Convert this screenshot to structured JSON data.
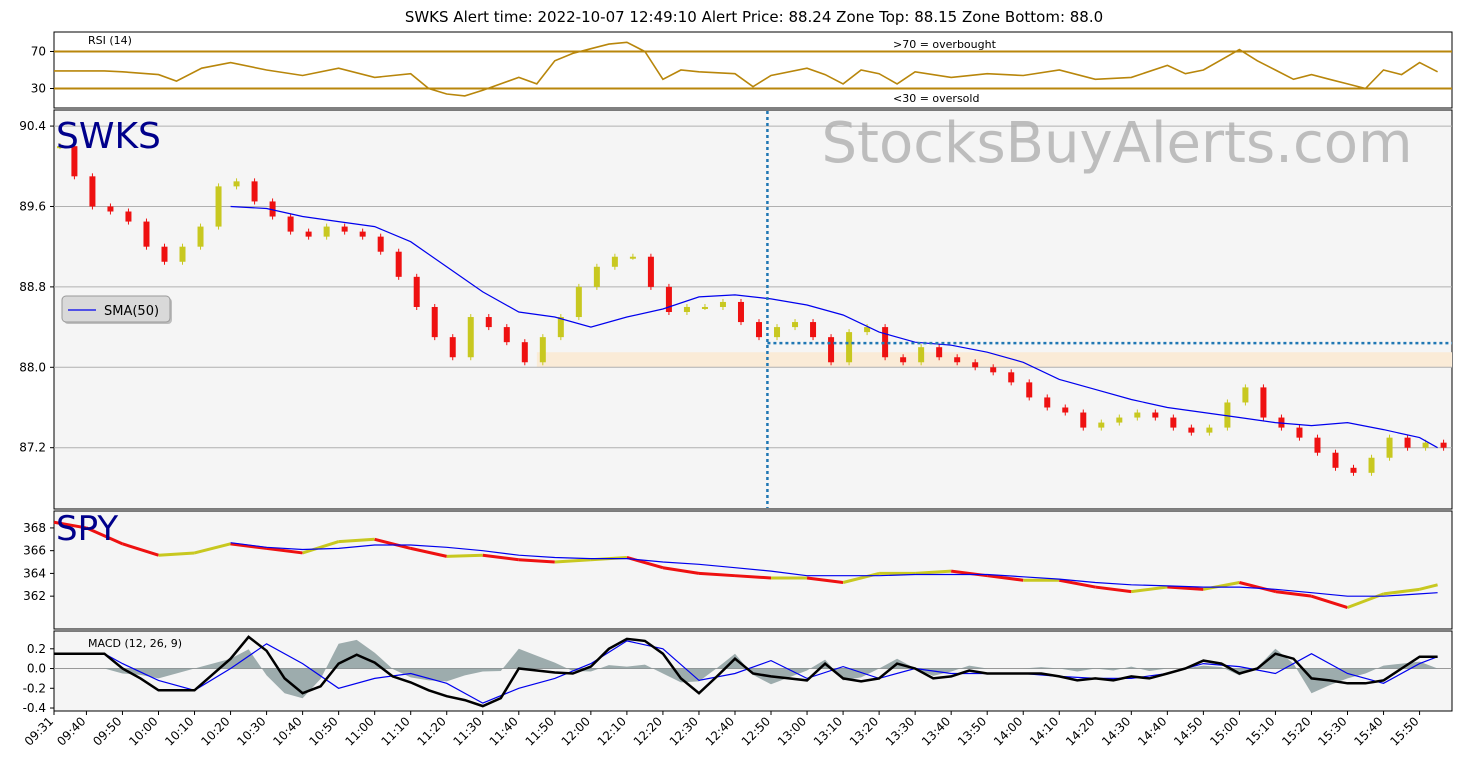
{
  "title": "SWKS   Alert time: 2022-10-07 12:49:10         Alert Price: 88.24       Zone Top: 88.15  Zone Bottom: 88.0",
  "watermark": "StocksBuyAlerts.com",
  "colors": {
    "up": "#c8c820",
    "down": "#ee1111",
    "sma": "#0000ee",
    "rsi": "#b8860b",
    "grid": "#b0b0b0",
    "panel_bg": "#f5f5f5",
    "zone": "#faebd7",
    "volume": "#add8e6",
    "alert_line": "#1f77b4",
    "ticker": "#00008b",
    "macd": "#000000",
    "macd_signal": "#0000ee",
    "macd_hist": "#7f9394"
  },
  "x_axis": {
    "tick_labels": [
      "09:31",
      "09:40",
      "09:50",
      "10:00",
      "10:10",
      "10:20",
      "10:30",
      "10:40",
      "10:50",
      "11:00",
      "11:10",
      "11:20",
      "11:30",
      "11:40",
      "11:50",
      "12:00",
      "12:10",
      "12:20",
      "12:30",
      "12:40",
      "12:50",
      "13:00",
      "13:10",
      "13:20",
      "13:30",
      "13:40",
      "13:50",
      "14:00",
      "14:10",
      "14:20",
      "14:30",
      "14:40",
      "14:50",
      "15:00",
      "15:10",
      "15:20",
      "15:30",
      "15:40",
      "15:50"
    ]
  },
  "chart_data": [
    {
      "type": "line",
      "panel": "rsi",
      "label": "RSI (14)",
      "ylim": [
        10,
        90
      ],
      "yticks": [
        30,
        70
      ],
      "overbought_label": ">70 = overbought",
      "oversold_label": "<30 = oversold",
      "series": [
        {
          "name": "RSI (14)",
          "x": [
            "09:31",
            "09:45",
            "09:50",
            "10:00",
            "10:05",
            "10:12",
            "10:20",
            "10:30",
            "10:40",
            "10:50",
            "11:00",
            "11:10",
            "11:15",
            "11:20",
            "11:25",
            "11:30",
            "11:40",
            "11:45",
            "11:50",
            "11:55",
            "12:00",
            "12:05",
            "12:10",
            "12:15",
            "12:20",
            "12:25",
            "12:30",
            "12:40",
            "12:45",
            "12:50",
            "13:00",
            "13:05",
            "13:10",
            "13:15",
            "13:20",
            "13:25",
            "13:30",
            "13:40",
            "13:50",
            "14:00",
            "14:10",
            "14:20",
            "14:30",
            "14:40",
            "14:45",
            "14:50",
            "15:00",
            "15:05",
            "15:10",
            "15:15",
            "15:20",
            "15:25",
            "15:30",
            "15:35",
            "15:40",
            "15:45",
            "15:50",
            "15:55"
          ],
          "values": [
            49,
            49,
            48,
            45,
            38,
            52,
            58,
            50,
            44,
            52,
            42,
            46,
            30,
            24,
            22,
            28,
            42,
            35,
            60,
            68,
            73,
            78,
            80,
            70,
            40,
            50,
            48,
            46,
            32,
            44,
            52,
            45,
            35,
            50,
            46,
            35,
            48,
            42,
            46,
            44,
            50,
            40,
            42,
            55,
            46,
            50,
            72,
            60,
            50,
            40,
            45,
            40,
            35,
            30,
            50,
            45,
            58,
            48
          ]
        }
      ]
    },
    {
      "type": "bar",
      "panel": "price",
      "ticker": "SWKS",
      "ylim": [
        86.6,
        90.55
      ],
      "yticks": [
        87.2,
        88.0,
        88.8,
        89.6,
        90.4
      ],
      "alert_time": "12:49",
      "alert_price": 88.24,
      "zone_top": 88.15,
      "zone_bottom": 88.0,
      "legend": "SMA(50)",
      "series": [
        {
          "name": "close",
          "x": [
            "09:31",
            "09:35",
            "09:40",
            "09:45",
            "09:50",
            "09:55",
            "10:00",
            "10:05",
            "10:10",
            "10:15",
            "10:20",
            "10:25",
            "10:30",
            "10:35",
            "10:40",
            "10:45",
            "10:50",
            "10:55",
            "11:00",
            "11:05",
            "11:10",
            "11:15",
            "11:20",
            "11:25",
            "11:30",
            "11:35",
            "11:40",
            "11:45",
            "11:50",
            "11:55",
            "12:00",
            "12:05",
            "12:10",
            "12:15",
            "12:20",
            "12:25",
            "12:30",
            "12:35",
            "12:40",
            "12:45",
            "12:50",
            "12:55",
            "13:00",
            "13:05",
            "13:10",
            "13:15",
            "13:20",
            "13:25",
            "13:30",
            "13:35",
            "13:40",
            "13:45",
            "13:50",
            "13:55",
            "14:00",
            "14:05",
            "14:10",
            "14:15",
            "14:20",
            "14:25",
            "14:30",
            "14:35",
            "14:40",
            "14:45",
            "14:50",
            "14:55",
            "15:00",
            "15:05",
            "15:10",
            "15:15",
            "15:20",
            "15:25",
            "15:30",
            "15:35",
            "15:40",
            "15:45",
            "15:50",
            "15:55"
          ],
          "values": [
            90.2,
            89.9,
            89.6,
            89.55,
            89.45,
            89.2,
            89.05,
            89.2,
            89.4,
            89.8,
            89.85,
            89.65,
            89.5,
            89.35,
            89.3,
            89.4,
            89.35,
            89.3,
            89.15,
            88.9,
            88.6,
            88.3,
            88.1,
            88.5,
            88.4,
            88.25,
            88.05,
            88.3,
            88.5,
            88.8,
            89.0,
            89.1,
            89.1,
            88.8,
            88.55,
            88.6,
            88.6,
            88.65,
            88.45,
            88.3,
            88.4,
            88.45,
            88.3,
            88.05,
            88.35,
            88.4,
            88.1,
            88.05,
            88.2,
            88.1,
            88.05,
            88.0,
            87.95,
            87.85,
            87.7,
            87.6,
            87.55,
            87.4,
            87.45,
            87.5,
            87.55,
            87.5,
            87.4,
            87.35,
            87.4,
            87.65,
            87.8,
            87.5,
            87.4,
            87.3,
            87.15,
            87.0,
            86.95,
            87.1,
            87.3,
            87.2,
            87.25,
            87.2
          ]
        },
        {
          "name": "SMA(50)",
          "x": [
            "10:20",
            "10:30",
            "10:40",
            "10:50",
            "11:00",
            "11:10",
            "11:20",
            "11:30",
            "11:40",
            "11:50",
            "12:00",
            "12:10",
            "12:20",
            "12:30",
            "12:40",
            "12:50",
            "13:00",
            "13:10",
            "13:20",
            "13:30",
            "13:40",
            "13:50",
            "14:00",
            "14:10",
            "14:20",
            "14:30",
            "14:40",
            "14:50",
            "15:00",
            "15:10",
            "15:20",
            "15:30",
            "15:40",
            "15:50",
            "15:55"
          ],
          "values": [
            89.6,
            89.58,
            89.5,
            89.45,
            89.4,
            89.25,
            89.0,
            88.75,
            88.55,
            88.5,
            88.4,
            88.5,
            88.58,
            88.7,
            88.72,
            88.68,
            88.62,
            88.52,
            88.35,
            88.25,
            88.22,
            88.15,
            88.05,
            87.88,
            87.78,
            87.68,
            87.6,
            87.55,
            87.5,
            87.45,
            87.42,
            87.45,
            87.38,
            87.3,
            87.2
          ]
        }
      ]
    },
    {
      "type": "line",
      "panel": "spy",
      "ticker": "SPY",
      "ylim": [
        359.2,
        369.4
      ],
      "yticks": [
        362,
        364,
        366,
        368
      ],
      "series": [
        {
          "name": "close",
          "x": [
            "09:31",
            "09:40",
            "09:50",
            "10:00",
            "10:10",
            "10:20",
            "10:30",
            "10:40",
            "10:50",
            "11:00",
            "11:10",
            "11:20",
            "11:30",
            "11:40",
            "11:50",
            "12:00",
            "12:10",
            "12:20",
            "12:30",
            "12:40",
            "12:50",
            "13:00",
            "13:10",
            "13:20",
            "13:30",
            "13:40",
            "13:50",
            "14:00",
            "14:10",
            "14:20",
            "14:30",
            "14:40",
            "14:50",
            "15:00",
            "15:10",
            "15:20",
            "15:30",
            "15:40",
            "15:50",
            "15:55"
          ],
          "values": [
            368.5,
            368.0,
            366.6,
            365.6,
            365.8,
            366.6,
            366.2,
            365.8,
            366.8,
            367.0,
            366.2,
            365.5,
            365.6,
            365.2,
            365.0,
            365.2,
            365.4,
            364.5,
            364.0,
            363.8,
            363.6,
            363.6,
            363.2,
            364.0,
            364.0,
            364.2,
            363.8,
            363.4,
            363.4,
            362.8,
            362.4,
            362.8,
            362.6,
            363.2,
            362.4,
            362.0,
            361.0,
            362.2,
            362.6,
            363.0
          ]
        },
        {
          "name": "SMA(50)",
          "x": [
            "10:20",
            "10:30",
            "10:40",
            "10:50",
            "11:00",
            "11:10",
            "11:20",
            "11:30",
            "11:40",
            "11:50",
            "12:00",
            "12:10",
            "12:20",
            "12:30",
            "12:40",
            "12:50",
            "13:00",
            "13:10",
            "13:20",
            "13:30",
            "13:40",
            "13:50",
            "14:00",
            "14:10",
            "14:20",
            "14:30",
            "14:40",
            "14:50",
            "15:00",
            "15:10",
            "15:20",
            "15:30",
            "15:40",
            "15:50",
            "15:55"
          ],
          "values": [
            366.7,
            366.3,
            366.1,
            366.2,
            366.5,
            366.5,
            366.3,
            366.0,
            365.6,
            365.4,
            365.3,
            365.3,
            365.0,
            364.8,
            364.5,
            364.2,
            363.8,
            363.8,
            363.8,
            363.9,
            363.9,
            363.9,
            363.7,
            363.5,
            363.2,
            363.0,
            362.9,
            362.8,
            362.8,
            362.6,
            362.3,
            362.0,
            362.0,
            362.2,
            362.3
          ]
        }
      ]
    },
    {
      "type": "line",
      "panel": "macd",
      "label": "MACD (12, 26, 9)",
      "ylim": [
        -0.42,
        0.37
      ],
      "yticks": [
        -0.4,
        -0.2,
        0.0,
        0.2
      ],
      "series": [
        {
          "name": "MACD",
          "x": [
            "09:31",
            "09:40",
            "09:45",
            "09:50",
            "09:55",
            "10:00",
            "10:10",
            "10:20",
            "10:25",
            "10:30",
            "10:35",
            "10:40",
            "10:45",
            "10:50",
            "10:55",
            "11:00",
            "11:05",
            "11:10",
            "11:15",
            "11:20",
            "11:25",
            "11:30",
            "11:35",
            "11:40",
            "11:45",
            "11:50",
            "11:55",
            "12:00",
            "12:05",
            "12:10",
            "12:15",
            "12:20",
            "12:25",
            "12:30",
            "12:35",
            "12:40",
            "12:45",
            "12:50",
            "12:55",
            "13:00",
            "13:05",
            "13:10",
            "13:15",
            "13:20",
            "13:25",
            "13:30",
            "13:35",
            "13:40",
            "13:45",
            "13:50",
            "13:55",
            "14:00",
            "14:05",
            "14:10",
            "14:15",
            "14:20",
            "14:25",
            "14:30",
            "14:35",
            "14:40",
            "14:45",
            "14:50",
            "14:55",
            "15:00",
            "15:05",
            "15:10",
            "15:15",
            "15:20",
            "15:25",
            "15:30",
            "15:35",
            "15:40",
            "15:45",
            "15:50",
            "15:55"
          ],
          "values": [
            0.15,
            0.15,
            0.15,
            0.0,
            -0.1,
            -0.22,
            -0.22,
            0.1,
            0.32,
            0.18,
            -0.1,
            -0.25,
            -0.18,
            0.05,
            0.14,
            0.06,
            -0.08,
            -0.14,
            -0.22,
            -0.28,
            -0.32,
            -0.38,
            -0.3,
            0.0,
            -0.02,
            -0.04,
            -0.05,
            0.02,
            0.2,
            0.3,
            0.28,
            0.15,
            -0.1,
            -0.25,
            -0.08,
            0.1,
            -0.05,
            -0.08,
            -0.1,
            -0.12,
            0.05,
            -0.1,
            -0.13,
            -0.1,
            0.05,
            0.0,
            -0.1,
            -0.08,
            -0.02,
            -0.05,
            -0.05,
            -0.05,
            -0.05,
            -0.08,
            -0.12,
            -0.1,
            -0.12,
            -0.08,
            -0.1,
            -0.05,
            0.0,
            0.08,
            0.05,
            -0.05,
            0.0,
            0.15,
            0.1,
            -0.1,
            -0.12,
            -0.15,
            -0.15,
            -0.12,
            0.0,
            0.12,
            0.12
          ]
        },
        {
          "name": "Signal",
          "x": [
            "09:31",
            "09:45",
            "09:50",
            "10:00",
            "10:10",
            "10:20",
            "10:30",
            "10:40",
            "10:50",
            "11:00",
            "11:10",
            "11:20",
            "11:30",
            "11:40",
            "11:50",
            "12:00",
            "12:10",
            "12:20",
            "12:30",
            "12:40",
            "12:50",
            "13:00",
            "13:10",
            "13:20",
            "13:30",
            "13:40",
            "13:50",
            "14:00",
            "14:10",
            "14:20",
            "14:30",
            "14:40",
            "14:50",
            "15:00",
            "15:10",
            "15:20",
            "15:30",
            "15:40",
            "15:50",
            "15:55"
          ],
          "values": [
            0.15,
            0.15,
            0.05,
            -0.12,
            -0.22,
            0.0,
            0.25,
            0.05,
            -0.2,
            -0.1,
            -0.05,
            -0.15,
            -0.35,
            -0.2,
            -0.1,
            0.05,
            0.28,
            0.2,
            -0.12,
            -0.05,
            0.08,
            -0.1,
            0.02,
            -0.1,
            0.0,
            -0.05,
            -0.05,
            -0.05,
            -0.08,
            -0.1,
            -0.1,
            -0.05,
            0.05,
            0.02,
            -0.05,
            0.15,
            -0.05,
            -0.15,
            0.05,
            0.12
          ]
        }
      ]
    }
  ]
}
